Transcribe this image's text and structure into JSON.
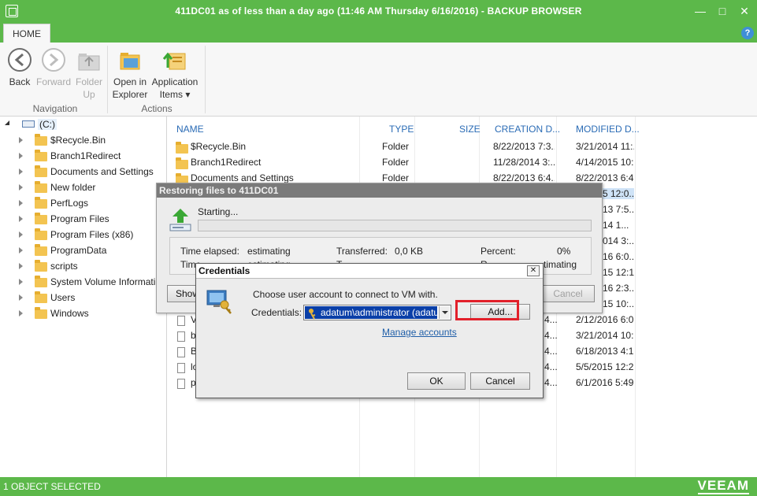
{
  "window": {
    "title": "411DC01 as of less than a day ago (11:46 AM Thursday 6/16/2016) - BACKUP BROWSER",
    "minimize": "—",
    "maximize": "□",
    "close": "✕"
  },
  "ribbon": {
    "tab": "HOME",
    "help": "?",
    "navigation": {
      "label": "Navigation",
      "back": "Back",
      "forward": "Forward",
      "folder_up": "Folder\nUp"
    },
    "actions": {
      "label": "Actions",
      "open_in_explorer": "Open in\nExplorer",
      "application_items": "Application\nItems ▾"
    }
  },
  "tree": {
    "root": "(C:)",
    "items": [
      "$Recycle.Bin",
      "Branch1Redirect",
      "Documents and Settings",
      "New folder",
      "PerfLogs",
      "Program Files",
      "Program Files (x86)",
      "ProgramData",
      "scripts",
      "System Volume Informati",
      "Users",
      "Windows"
    ]
  },
  "list": {
    "headers": [
      "NAME",
      "TYPE",
      "SIZE",
      "CREATION D...",
      "MODIFIED D..."
    ],
    "rows": [
      {
        "name": "$Recycle.Bin",
        "type": "Folder",
        "created": "8/22/2013 7:3...",
        "modified": "3/21/2014 11:..."
      },
      {
        "name": "Branch1Redirect",
        "type": "Folder",
        "created": "11/28/2014 3:...",
        "modified": "4/14/2015 10:..."
      },
      {
        "name": "Documents and Settings",
        "type": "Folder",
        "created": "8/22/2013 6:4...",
        "modified": "8/22/2013 6:4..."
      }
    ],
    "partial_modified": [
      "5 12:0...",
      "13 7:5...",
      "14 1...",
      "014 3:...",
      "16 6:0...",
      "15 12:1...",
      "16 2:3...",
      "15 10:..."
    ],
    "partial_rows": [
      {
        "name": "V",
        "created": "4...",
        "modified": "2/12/2016 6:0..."
      },
      {
        "name": "b",
        "created": "4...",
        "modified": "3/21/2014 10:..."
      },
      {
        "name": "B",
        "created": "4...",
        "modified": "6/18/2013 4:1..."
      },
      {
        "name": "lo",
        "created": "4...",
        "modified": "5/5/2015 12:2..."
      },
      {
        "name": "p",
        "created": "4...",
        "modified": "6/1/2016 5:49..."
      }
    ]
  },
  "restore_dialog": {
    "title": "Restoring files to 411DC01",
    "status": "Starting...",
    "time_elapsed_label": "Time elapsed:",
    "time_elapsed_value": "estimating",
    "transferred_label": "Transferred:",
    "transferred_value": "0,0 KB",
    "percent_label": "Percent:",
    "percent_value": "0%",
    "time_remaining_label": "Time",
    "time_remaining_value": "estimating",
    "transferred2_label": "T",
    "remaining_label": "R",
    "remaining_value": "timating",
    "show_button": "Show",
    "cancel_button": "Cancel"
  },
  "credentials_dialog": {
    "title": "Credentials",
    "prompt": "Choose user account to connect to VM with.",
    "credentials_label": "Credentials:",
    "credentials_value": "adatum\\administrator (adatum\\a",
    "add_button": "Add...",
    "manage_accounts": "Manage accounts",
    "ok_button": "OK",
    "cancel_button": "Cancel"
  },
  "statusbar": {
    "text": "1 OBJECT SELECTED",
    "logo": "VEEAM"
  },
  "colors": {
    "brand_green": "#5cb84a",
    "highlight_red": "#e2202a",
    "header_blue": "#2a6bb5"
  }
}
